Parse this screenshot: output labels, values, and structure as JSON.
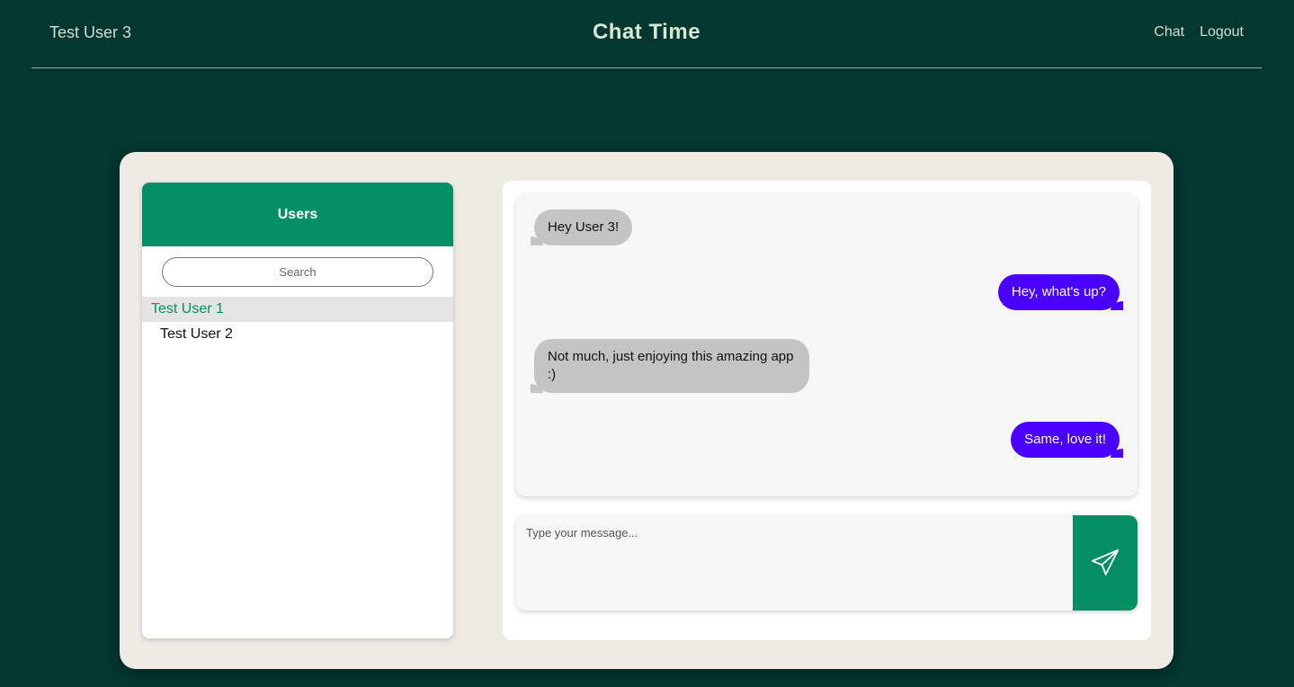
{
  "header": {
    "current_user": "Test User 3",
    "brand": "Chat Time",
    "nav": [
      "Chat",
      "Logout"
    ]
  },
  "users_panel": {
    "title": "Users",
    "search_placeholder": "Search",
    "users": [
      "Test User 1",
      "Test User 2"
    ],
    "selected_user": "Test User 1"
  },
  "chat": {
    "messages": [
      {
        "from": "other",
        "text": "Hey User 3!"
      },
      {
        "from": "me",
        "text": "Hey, what's up?"
      },
      {
        "from": "other",
        "text": "Not much, just enjoying this amazing app :)"
      },
      {
        "from": "me",
        "text": "Same, love it!"
      }
    ],
    "input_placeholder": "Type your message...",
    "send_icon": "paper-plane-icon"
  },
  "colors": {
    "background": "#043730",
    "card": "#eeebe5",
    "accent_green": "#038f63",
    "outgoing_bubble": "#4a00ff",
    "incoming_bubble": "#c4c4c4"
  }
}
